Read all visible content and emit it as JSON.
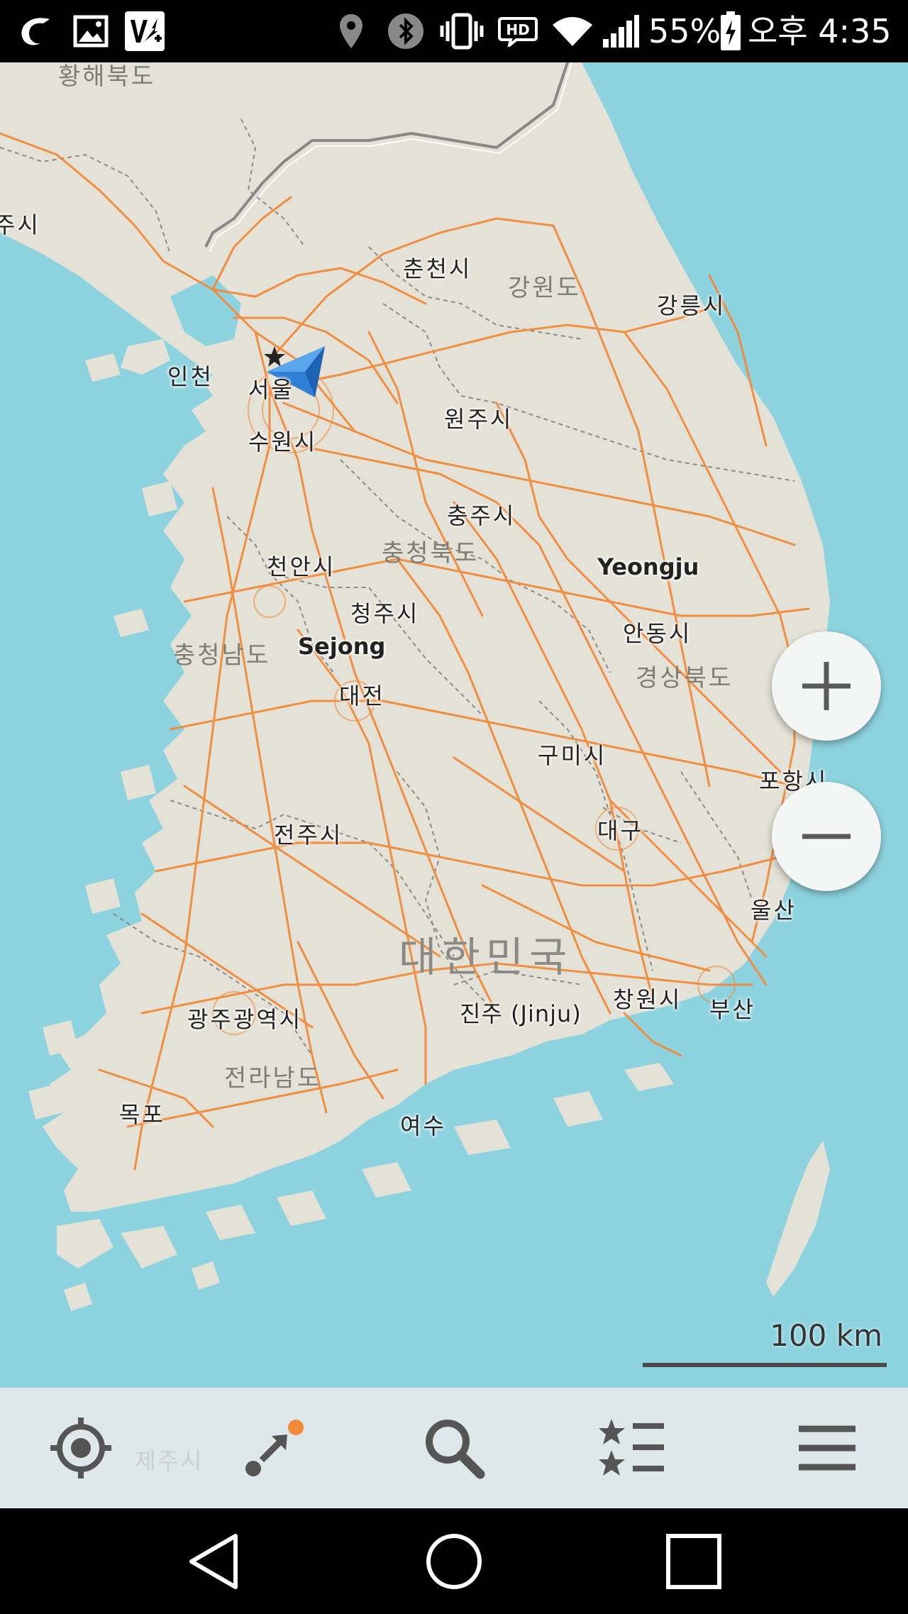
{
  "status_bar": {
    "battery": "55%",
    "time": "오후 4:35",
    "icons": [
      "opera-icon",
      "gallery-icon",
      "vpn-icon",
      "location-icon",
      "bluetooth-icon",
      "vibrate-icon",
      "hd-voice-icon",
      "wifi-icon",
      "signal-icon",
      "battery-charging-icon"
    ]
  },
  "map": {
    "labels": {
      "hwanghae": "황해북도",
      "left_edge": "주시",
      "chuncheon": "춘천시",
      "gangwon": "강원도",
      "gangneung": "강릉시",
      "incheon": "인천",
      "seoul": "서울",
      "suwon": "수원시",
      "wonju": "원주시",
      "chungju": "충주시",
      "chungbuk": "충청북도",
      "yeongju": "Yeongju",
      "cheonan": "천안시",
      "cheongju": "청주시",
      "andong": "안동시",
      "chungnam": "충청남도",
      "sejong": "Sejong",
      "gyeongbuk": "경상북도",
      "daejeon": "대전",
      "gumi": "구미시",
      "pohang": "포항시",
      "jeonju": "전주시",
      "daegu": "대구",
      "ulsan": "울산",
      "country": "대한민국",
      "changwon": "창원시",
      "busan": "부산",
      "gwangju": "광주광역시",
      "jinju": "진주 (Jinju)",
      "jeonnam": "전라남도",
      "mokpo": "목포",
      "yeosu": "여수",
      "jeju": "제주시"
    },
    "scale": "100 km",
    "zoom_in_icon": "plus-icon",
    "zoom_out_icon": "minus-icon",
    "position_marker": "navigation-arrow-icon",
    "colors": {
      "sea": "#8dd3df",
      "land": "#e4e2d6",
      "roads": "#f28a3a",
      "marker": "#3b8fe0"
    }
  },
  "toolbar": {
    "icons": [
      "my-location-icon",
      "route-icon",
      "search-icon",
      "bookmarks-icon",
      "menu-icon"
    ]
  },
  "nav_bar": {
    "icons": [
      "back-icon",
      "home-icon",
      "recents-icon"
    ]
  }
}
